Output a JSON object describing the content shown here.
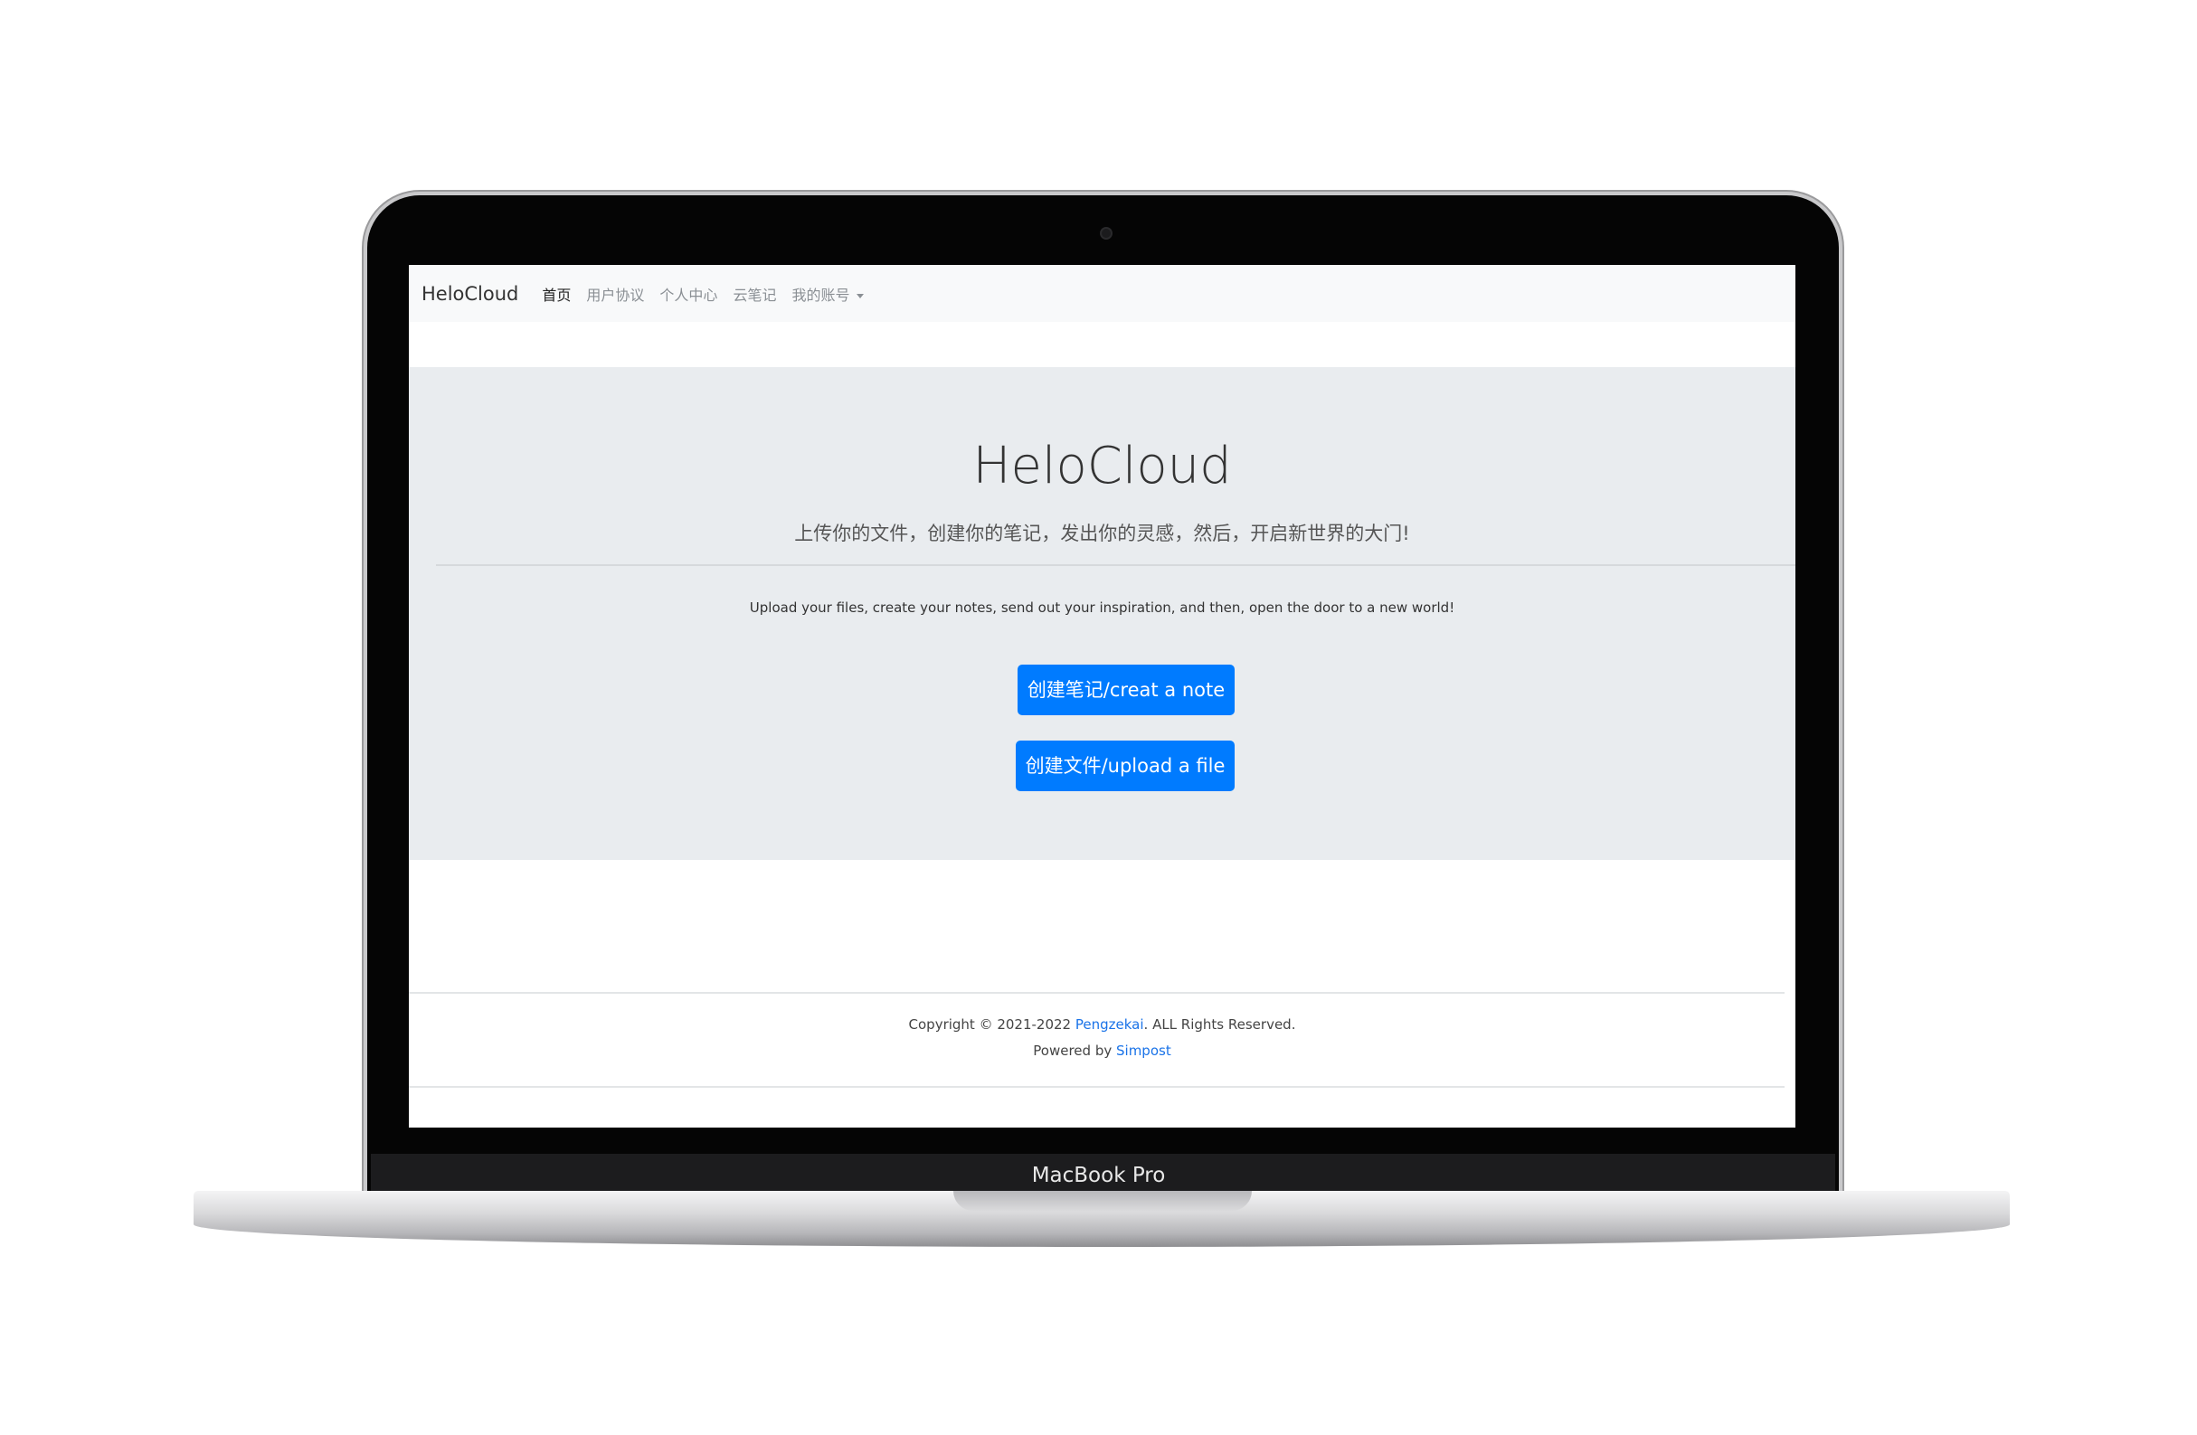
{
  "device": {
    "label": "MacBook Pro"
  },
  "navbar": {
    "brand": "HeloCloud",
    "links": [
      {
        "label": "首页"
      },
      {
        "label": "用户协议"
      },
      {
        "label": "个人中心"
      },
      {
        "label": "云笔记"
      },
      {
        "label": "我的账号"
      }
    ]
  },
  "hero": {
    "title": "HeloCloud",
    "lead": "上传你的文件，创建你的笔记，发出你的灵感，然后，开启新世界的大门!",
    "text": "Upload your files, create your notes, send out your inspiration, and then, open the door to a new world!",
    "create_note_label": "创建笔记/creat a note",
    "upload_file_label": "创建文件/upload a file"
  },
  "footer": {
    "copyright_prefix": "Copyright © 2021-2022 ",
    "author": "Pengzekai",
    "copyright_suffix": ". ALL Rights Reserved.",
    "powered_prefix": "Powered by ",
    "powered_by": "Simpost"
  },
  "colors": {
    "primary": "#007bff",
    "navbar_bg": "#f8f9fa",
    "jumbotron_bg": "#e9ecef",
    "link": "#1a73e8"
  }
}
